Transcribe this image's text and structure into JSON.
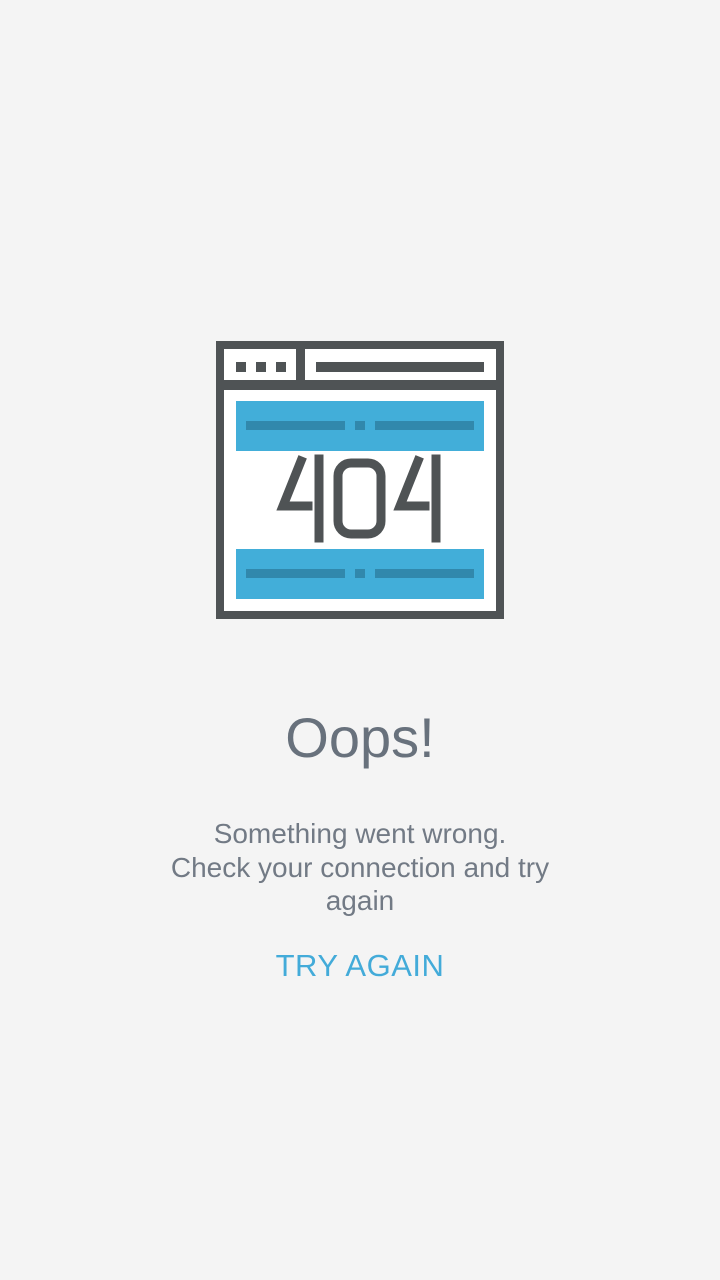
{
  "illustration": {
    "icon": "browser-window-404-icon",
    "code": "404",
    "colors": {
      "frame": "#4f5355",
      "band": "#42aed9",
      "band_dash": "#3188ac",
      "screen": "#ffffff"
    }
  },
  "error": {
    "title": "Oops!",
    "message_lines": [
      "Something went wrong.",
      "Check your connection and try",
      "again"
    ]
  },
  "actions": {
    "retry_label": "TRY AGAIN"
  },
  "colors": {
    "background": "#f4f4f4",
    "text": "#68717c",
    "accent": "#43abd9"
  }
}
